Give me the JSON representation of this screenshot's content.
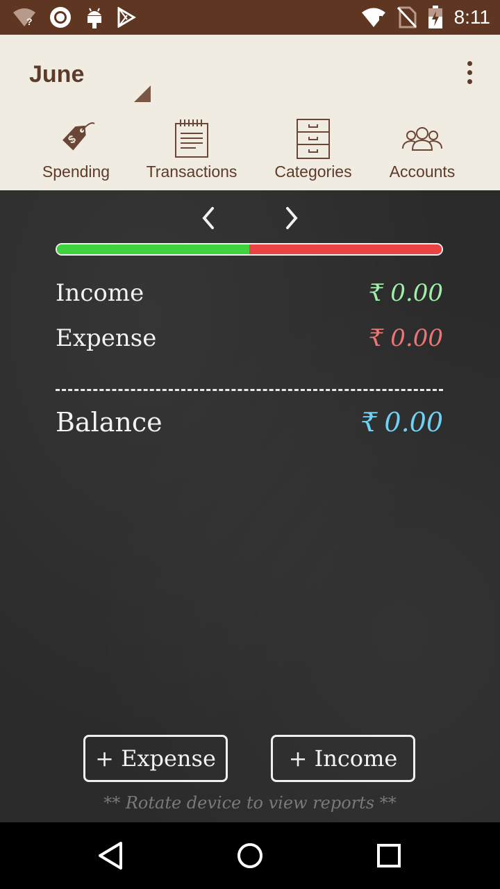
{
  "status_bar": {
    "time": "8:11",
    "icons": [
      "wifi-question-icon",
      "circle-app-icon",
      "android-icon",
      "play-store-icon",
      "wifi-alert-icon",
      "no-sim-icon",
      "battery-charging-icon"
    ]
  },
  "app_bar": {
    "month": "June",
    "menu_icon": "overflow-menu-icon"
  },
  "tabs": [
    {
      "label": "Spending",
      "icon": "price-tag-icon",
      "selected": true
    },
    {
      "label": "Transactions",
      "icon": "notepad-icon",
      "selected": false
    },
    {
      "label": "Categories",
      "icon": "drawer-cabinet-icon",
      "selected": false
    },
    {
      "label": "Accounts",
      "icon": "people-icon",
      "selected": false
    }
  ],
  "summary": {
    "income_label": "Income",
    "income_currency": "₹",
    "income_value": "0.00",
    "expense_label": "Expense",
    "expense_currency": "₹",
    "expense_value": "0.00",
    "balance_label": "Balance",
    "balance_currency": "₹",
    "balance_value": "0.00",
    "income_share": 0.5
  },
  "buttons": {
    "add_expense": "+ Expense",
    "add_income": "+ Income"
  },
  "hint": "** Rotate device to view reports **",
  "colors": {
    "status_bar": "#5e3622",
    "app_bar": "#f0ece1",
    "board": "#2b2b2b",
    "income": "#9ef0a8",
    "expense": "#f07474",
    "balance": "#6fd2f5"
  }
}
